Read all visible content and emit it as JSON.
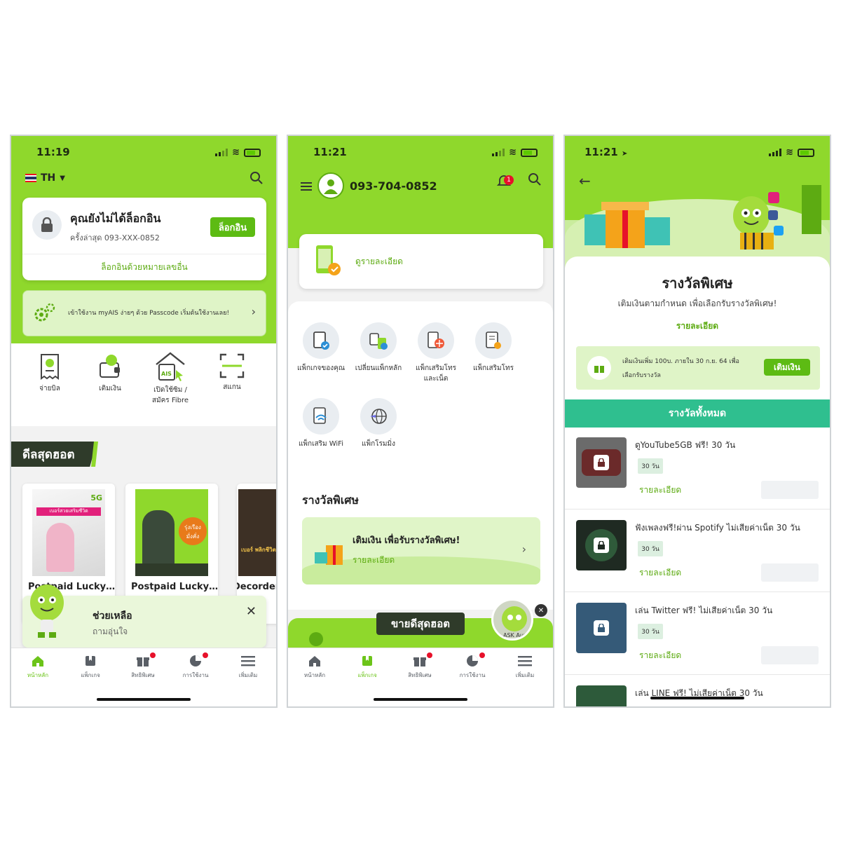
{
  "screen1": {
    "status_time": "11:19",
    "lang": "TH",
    "login_card": {
      "title": "คุณยังไม่ได้ล็อกอิน",
      "subtitle": "ครั้งล่าสุด 093-XXX-0852",
      "login_button": "ล็อกอิน",
      "other_number": "ล็อกอินด้วยหมายเลขอื่น"
    },
    "passcode_banner": "เข้าใช้งาน myAIS ง่ายๆ ด้วย Passcode เริ่มต้นใช้งานเลย!",
    "quick_actions": [
      {
        "label": "จ่ายบิล",
        "icon": "bill-icon"
      },
      {
        "label": "เติมเงิน",
        "icon": "topup-icon"
      },
      {
        "label": "เปิดใช้ซิม / สมัคร Fibre",
        "icon": "sim-fibre-icon"
      },
      {
        "label": "สแกน",
        "icon": "scan-icon"
      }
    ],
    "deals_title": "ดีลสุดฮอต",
    "promos": [
      {
        "title": "Postpaid Lucky…",
        "poster_text": "เบอร์สวยเสริมชีวิต"
      },
      {
        "title": "Postpaid Lucky…",
        "poster_text": "รุ่งเรือง มั่งคั่ง"
      },
      {
        "title": "Decorder",
        "poster_text": "เบอร์ พลิกชีวิต"
      }
    ],
    "help_popup": {
      "title": "ช่วยเหลือ",
      "subtitle": "ถามอุ่นใจ"
    },
    "tabs": [
      {
        "label": "หน้าหลัก",
        "icon": "home-icon",
        "active": true,
        "dot": false
      },
      {
        "label": "แพ็กเกจ",
        "icon": "package-icon",
        "active": false,
        "dot": false
      },
      {
        "label": "สิทธิพิเศษ",
        "icon": "gift-icon",
        "active": false,
        "dot": true
      },
      {
        "label": "การใช้งาน",
        "icon": "usage-icon",
        "active": false,
        "dot": true
      },
      {
        "label": "เพิ่มเติม",
        "icon": "menu-icon",
        "active": false,
        "dot": false
      }
    ]
  },
  "screen2": {
    "status_time": "11:21",
    "phone_number": "093-704-0852",
    "notification_count": "1",
    "detail_link": "ดูรายละเอียด",
    "packages": [
      {
        "label": "แพ็กเกจของคุณ",
        "icon": "my-package-icon"
      },
      {
        "label": "เปลี่ยนแพ็กหลัก",
        "icon": "change-package-icon"
      },
      {
        "label": "แพ็กเสริมโทร และเน็ต",
        "icon": "call-net-addon-icon"
      },
      {
        "label": "แพ็กเสริมโทร",
        "icon": "call-addon-icon"
      },
      {
        "label": "แพ็กเสริม WiFi",
        "icon": "wifi-addon-icon"
      },
      {
        "label": "แพ็กโรมมิ่ง",
        "icon": "roaming-icon"
      }
    ],
    "special_reward_title": "รางวัลพิเศษ",
    "reward_card": {
      "title": "เติมเงิน เพื่อรับรางวัลพิเศษ!",
      "link": "รายละเอียด"
    },
    "hot_sale_label": "ขายดีสุดฮอต",
    "ask_label": "ASK Aunjai",
    "tabs": [
      {
        "label": "หน้าหลัก",
        "icon": "home-icon",
        "active": false,
        "dot": false
      },
      {
        "label": "แพ็กเกจ",
        "icon": "package-icon",
        "active": true,
        "dot": false
      },
      {
        "label": "สิทธิพิเศษ",
        "icon": "gift-icon",
        "active": false,
        "dot": true
      },
      {
        "label": "การใช้งาน",
        "icon": "usage-icon",
        "active": false,
        "dot": true
      },
      {
        "label": "เพิ่มเติม",
        "icon": "menu-icon",
        "active": false,
        "dot": false
      }
    ]
  },
  "screen3": {
    "status_time": "11:21",
    "title": "รางวัลพิเศษ",
    "subtitle": "เติมเงินตามกำหนด เพื่อเลือกรับรางวัลพิเศษ!",
    "detail_link": "รายละเอียด",
    "topup_banner": {
      "line1": "เติมเงินเพิ่ม 100บ. ภายใน 30 ก.ย. 64 เพื่อ",
      "line2": "เลือกรับรางวัล",
      "button": "เติมเงิน"
    },
    "all_rewards_header": "รางวัลทั้งหมด",
    "rewards": [
      {
        "title": "ดูYouTube5GB ฟรี!  30 วัน",
        "days": "30 วัน",
        "detail": "รายละเอียด",
        "color": "#6b2a2a",
        "icon": "youtube-icon"
      },
      {
        "title": "ฟังเพลงฟรี!ผ่าน Spotify ไม่เสียค่าเน็ต 30 วัน",
        "days": "30 วัน",
        "detail": "รายละเอียด",
        "color": "#1f2a22",
        "icon": "spotify-icon"
      },
      {
        "title": "เล่น Twitter ฟรี! ไม่เสียค่าเน็ต 30 วัน",
        "days": "30 วัน",
        "detail": "รายละเอียด",
        "color": "#355a78",
        "icon": "twitter-icon"
      },
      {
        "title": "เล่น LINE ฟรี! ไม่เสียค่าเน็ต 30 วัน",
        "days": "",
        "detail": "",
        "color": "#2d5a3a",
        "icon": "line-icon"
      }
    ]
  }
}
